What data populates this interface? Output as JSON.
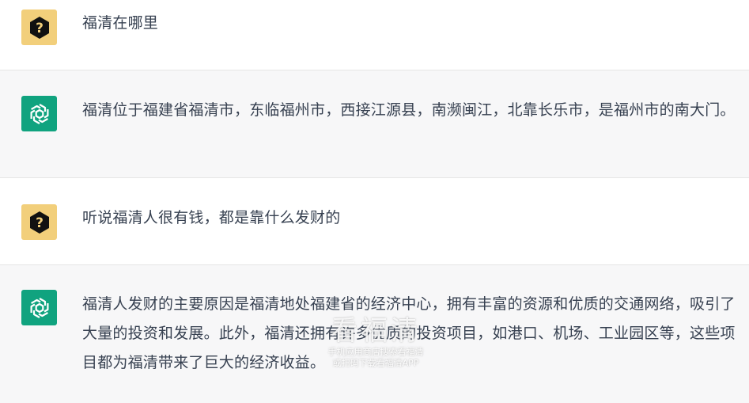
{
  "conversation": [
    {
      "role": "user",
      "avatar_icon": "question-mark-icon",
      "text": "福清在哪里"
    },
    {
      "role": "assistant",
      "avatar_icon": "openai-logo-icon",
      "text": "福清位于福建省福清市，东临福州市，西接江源县，南濒闽江，北靠长乐市，是福州市的南大门。"
    },
    {
      "role": "user",
      "avatar_icon": "question-mark-icon",
      "text": "听说福清人很有钱，都是靠什么发财的"
    },
    {
      "role": "assistant",
      "avatar_icon": "openai-logo-icon",
      "text": "福清人发财的主要原因是福清地处福建省的经济中心，拥有丰富的资源和优质的交通网络，吸引了大量的投资和发展。此外，福清还拥有许多优质的投资项目，如港口、机场、工业园区等，这些项目都为福清带来了巨大的经济收益。"
    }
  ],
  "watermark": {
    "main": "看福清",
    "line1": "手机应用商店搜索看福清",
    "line2": "或扫码下载看福清APP"
  },
  "colors": {
    "user_avatar_bg": "#f2cf7b",
    "bot_avatar_bg": "#10a37f",
    "bot_row_bg": "#f7f7f8",
    "text": "#374151"
  }
}
